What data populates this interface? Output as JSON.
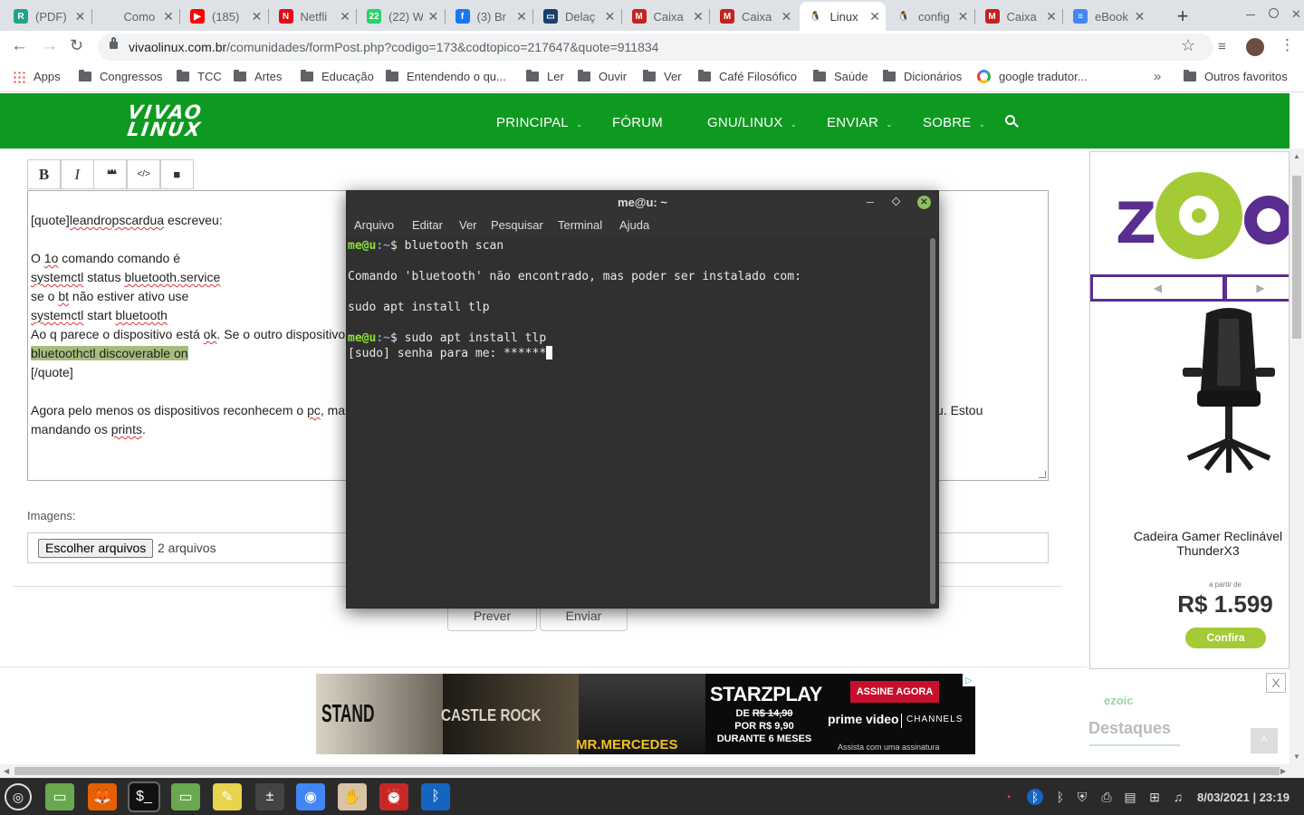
{
  "browser": {
    "tabs": [
      {
        "label": "(PDF)",
        "fav": "R",
        "favcolor": "#20a38b",
        "active": false
      },
      {
        "label": "Como",
        "fav": "",
        "favcolor": "#dee1e6",
        "active": false
      },
      {
        "label": "(185)",
        "fav": "▶",
        "favcolor": "#ff0000",
        "active": false
      },
      {
        "label": "Netfli",
        "fav": "N",
        "favcolor": "#e50914",
        "active": false
      },
      {
        "label": "(22) W",
        "fav": "22",
        "favcolor": "#25d366",
        "active": false
      },
      {
        "label": "(3) Br",
        "fav": "f",
        "favcolor": "#1877f2",
        "active": false
      },
      {
        "label": "Delaç",
        "fav": "▭",
        "favcolor": "#1a3e6e",
        "active": false
      },
      {
        "label": "Caixa",
        "fav": "M",
        "favcolor": "#c5221f",
        "active": false
      },
      {
        "label": "Caixa",
        "fav": "M",
        "favcolor": "#c5221f",
        "active": false
      },
      {
        "label": "Linux",
        "fav": "🐧",
        "favcolor": "#ffffff",
        "active": true
      },
      {
        "label": "config",
        "fav": "🐧",
        "favcolor": "#ffffff",
        "active": false
      },
      {
        "label": "Caixa",
        "fav": "M",
        "favcolor": "#c5221f",
        "active": false
      },
      {
        "label": "eBook",
        "fav": "≡",
        "favcolor": "#4285f4",
        "active": false
      }
    ],
    "new_tab_label": "+",
    "url_host": "vivaolinux.com.br",
    "url_path": "/comunidades/formPost.php?codigo=173&codtopico=217647&quote=911834",
    "bookmarks": [
      "Apps",
      "Congressos",
      "TCC",
      "Artes",
      "Educação",
      "Entendendo o qu...",
      "Ler",
      "Ouvir",
      "Ver",
      "Café Filosófico",
      "Saúde",
      "Dicionários",
      "google tradutor..."
    ],
    "bookmarks_overflow": "»",
    "other_bookmarks": "Outros favoritos"
  },
  "site": {
    "logo_line1": "VIVAO",
    "logo_line2": "LINUX",
    "nav": [
      {
        "label": "PRINCIPAL",
        "dropdown": true
      },
      {
        "label": "FÓRUM",
        "dropdown": false
      },
      {
        "label": "GNU/LINUX",
        "dropdown": true
      },
      {
        "label": "ENVIAR",
        "dropdown": true
      },
      {
        "label": "SOBRE",
        "dropdown": true
      }
    ],
    "nav_caret": "⌄",
    "search_icon": "search-icon",
    "editor_toolbar": [
      {
        "name": "bold",
        "glyph": "B"
      },
      {
        "name": "italic",
        "glyph": "I"
      },
      {
        "name": "quote",
        "glyph": "❝❝"
      },
      {
        "name": "code",
        "glyph": "</>"
      },
      {
        "name": "video",
        "glyph": "■"
      }
    ],
    "post": {
      "q_open": "[quote]",
      "q_author": "leandropscardua",
      "q_wrote": " escreveu:",
      "l1a": "O ",
      "l1b": "1o",
      "l1c": " comando comando é",
      "l2a": "systemctl",
      "l2b": " status ",
      "l2c": "bluetooth.service",
      "l3a": "se o ",
      "l3b": "bt",
      "l3c": " não estiver ativo use",
      "l4a": "systemctl",
      "l4b": " start ",
      "l4c": "bluetooth",
      "l5a": "Ao q parece o dispositivo está ",
      "l5b": "ok",
      "l5c": ". Se o outro dispositivo",
      "l6": "bluetoothctl discoverable on",
      "q_close": "[/quote]",
      "p2a": "Agora pelo menos os dispositivos reconhecem o ",
      "p2b": "pc",
      "p2c": ", mas",
      "p2d": "u. Estou",
      "p3a": "mandando os ",
      "p3b": "prints",
      "p3c": "."
    },
    "images_label": "Imagens:",
    "file_button": "Escolher arquivos",
    "file_status": "2 arquivos",
    "preview_button": "Prever",
    "send_button": "Enviar"
  },
  "ads": {
    "right": {
      "brand": "ZOOM",
      "nav_prev": "◀",
      "nav_next": "▶",
      "product": "Cadeira Gamer Reclinável ThunderX3",
      "price_prefix": "a partir de",
      "price": "R$ 1.599",
      "cta": "Confira",
      "close": "X",
      "network": "ezoic",
      "sidebar_heading": "Destaques"
    },
    "bottom": {
      "titles": [
        "STAND",
        "CASTLE ROCK",
        "MR.MERCEDES"
      ],
      "brand": "STARZPLAY",
      "cta": "ASSINE AGORA",
      "old_price_prefix": "DE ",
      "old_price": "R$ 14,90",
      "new_price": "POR R$ 9,90",
      "duration": "DURANTE 6 MESES",
      "channels_a": "prime video",
      "channels_b": "CHANNELS",
      "sub": "Assista com uma assinatura",
      "info_icon": "▷"
    }
  },
  "terminal": {
    "title": "me@u: ~",
    "menu": [
      "Arquivo",
      "Editar",
      "Ver",
      "Pesquisar",
      "Terminal",
      "Ajuda"
    ],
    "prompt_user": "me@u",
    "prompt_path": ":~",
    "prompt_sign": "$ ",
    "cmd1": "bluetooth scan",
    "out1": "Comando 'bluetooth' não encontrado, mas poder ser instalado com:",
    "out2": "sudo apt install tlp",
    "cmd2": "sudo apt install tlp",
    "out3": "[sudo] senha para me: ******"
  },
  "taskbar": {
    "apps": [
      "mint-menu-icon",
      "files-green-icon",
      "firefox-icon",
      "terminal-icon",
      "files-icon",
      "notes-icon",
      "calculator-icon",
      "chrome-icon",
      "hand-icon",
      "clock-icon",
      "bluetooth-app-icon"
    ],
    "tray": [
      "timer-icon",
      "bluetooth-icon",
      "bluetooth-icon",
      "shield-icon",
      "printer-icon",
      "clipboard-icon",
      "network-icon",
      "music-icon"
    ],
    "clock": "8/03/2021 | 23:19"
  }
}
